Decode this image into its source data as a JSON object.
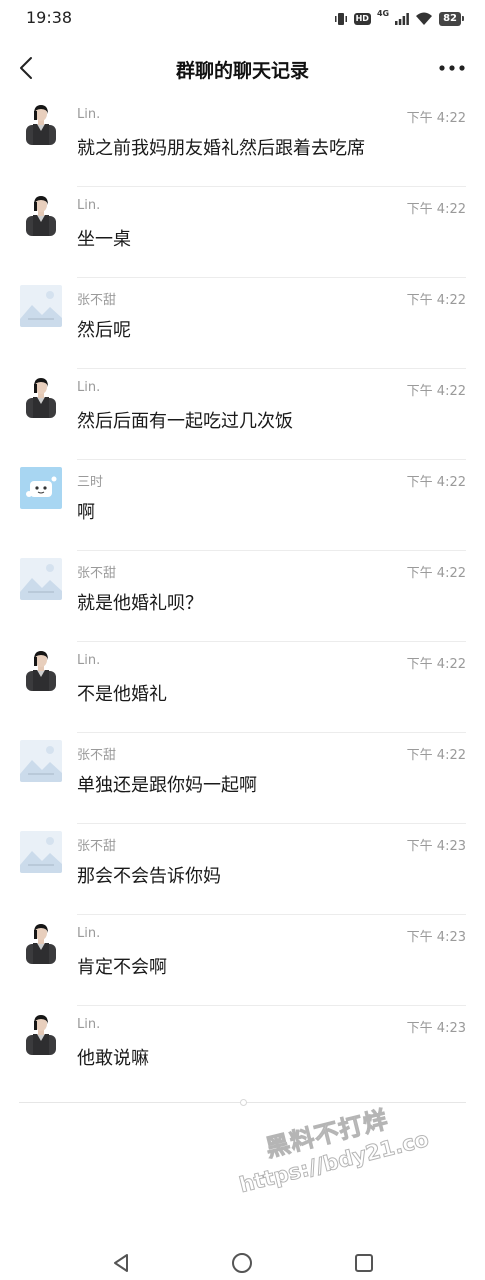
{
  "status_bar": {
    "time": "19:38",
    "hd_label": "HD",
    "network_label": "4G",
    "battery": "82"
  },
  "header": {
    "title": "群聊的聊天记录",
    "back_icon": "chevron-left-icon",
    "more_icon": "more-dots-icon"
  },
  "messages": [
    {
      "sender": "Lin.",
      "time": "下午 4:22",
      "text": "就之前我妈朋友婚礼然后跟着去吃席",
      "avatar": "lin-avatar"
    },
    {
      "sender": "Lin.",
      "time": "下午 4:22",
      "text": "坐一桌",
      "avatar": "lin-avatar"
    },
    {
      "sender": "张不甜",
      "time": "下午 4:22",
      "text": "然后呢",
      "avatar": "zhang-avatar"
    },
    {
      "sender": "Lin.",
      "time": "下午 4:22",
      "text": "然后后面有一起吃过几次饭",
      "avatar": "lin-avatar"
    },
    {
      "sender": "三时",
      "time": "下午 4:22",
      "text": "啊",
      "avatar": "sanshi-avatar"
    },
    {
      "sender": "张不甜",
      "time": "下午 4:22",
      "text": "就是他婚礼呗？",
      "avatar": "zhang-avatar"
    },
    {
      "sender": "Lin.",
      "time": "下午 4:22",
      "text": "不是他婚礼",
      "avatar": "lin-avatar"
    },
    {
      "sender": "张不甜",
      "time": "下午 4:22",
      "text": "单独还是跟你妈一起啊",
      "avatar": "zhang-avatar"
    },
    {
      "sender": "张不甜",
      "time": "下午 4:23",
      "text": "那会不会告诉你妈",
      "avatar": "zhang-avatar"
    },
    {
      "sender": "Lin.",
      "time": "下午 4:23",
      "text": "肯定不会啊",
      "avatar": "lin-avatar"
    },
    {
      "sender": "Lin.",
      "time": "下午 4:23",
      "text": "他敢说嘛",
      "avatar": "lin-avatar"
    }
  ],
  "watermark": {
    "line1": "黑料不打烊",
    "line2": "https://bdy21.co"
  },
  "system_nav": {
    "back_icon": "triangle-back-icon",
    "home_icon": "circle-home-icon",
    "recents_icon": "square-recents-icon"
  },
  "colors": {
    "background": "#ffffff",
    "text_primary": "#1a1a1a",
    "text_secondary": "#9a9a9a",
    "divider": "#ececec"
  }
}
